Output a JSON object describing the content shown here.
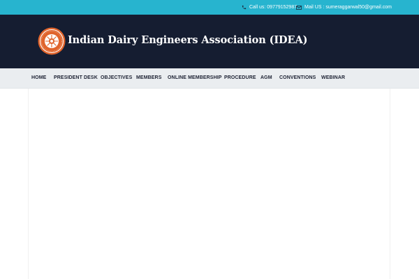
{
  "topbar": {
    "phone": "Call us: 09779152987",
    "mail": "Mail US : sumeraggarwal50@gmail.com",
    "phone_icon": "phone-icon",
    "mail_icon": "envelope-icon"
  },
  "header": {
    "title": "Indian Dairy Engineers Association (IDEA)",
    "logo_icon": "idea-emblem-logo"
  },
  "nav": {
    "items": [
      {
        "label": "HOME"
      },
      {
        "label": "PRESIDENT DESK"
      },
      {
        "label": "OBJECTIVES"
      },
      {
        "label": "MEMBERS"
      },
      {
        "label": "ONLINE MEMBERSHIP"
      },
      {
        "label": "PROCEDURE"
      },
      {
        "label": "AGM"
      },
      {
        "label": "CONVENTIONS"
      },
      {
        "label": "WEBINAR"
      }
    ]
  },
  "colors": {
    "topbar": "#27b4cf",
    "header": "#151d31",
    "nav": "#eaedf0",
    "logo_orange": "#e0642c"
  }
}
